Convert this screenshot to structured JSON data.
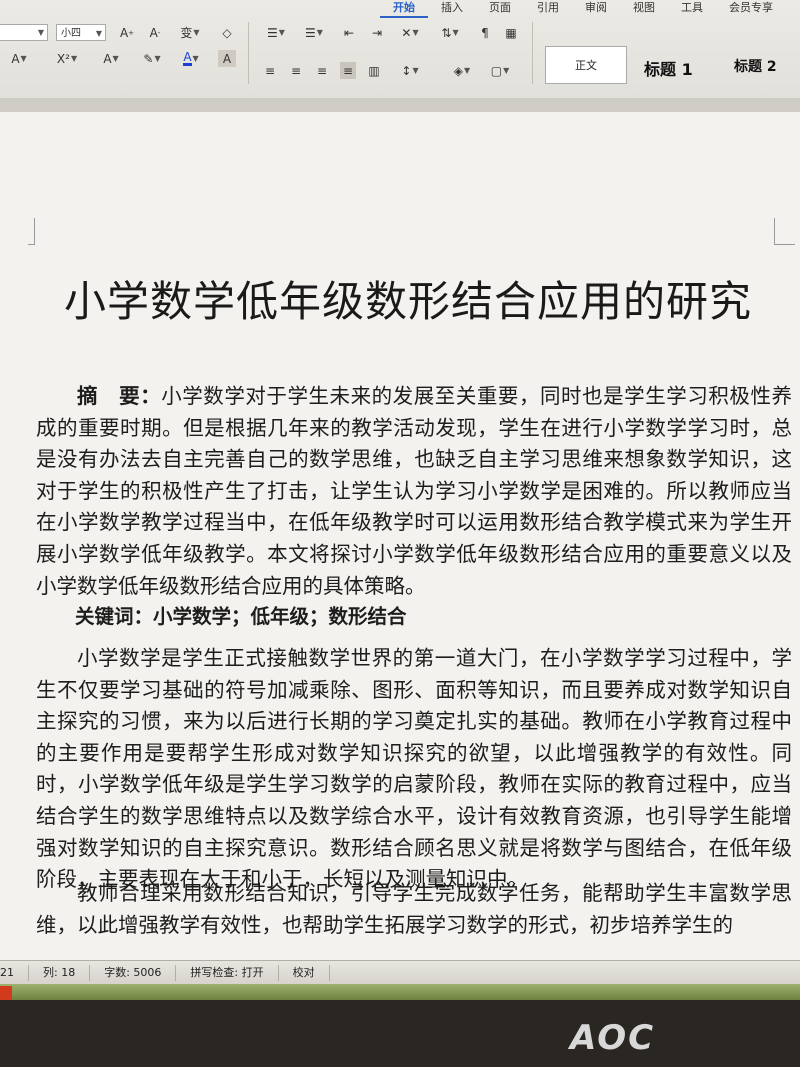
{
  "ribbon": {
    "tabs": [
      {
        "label": "开始",
        "active": true
      },
      {
        "label": "插入"
      },
      {
        "label": "页面"
      },
      {
        "label": "引用"
      },
      {
        "label": "审阅"
      },
      {
        "label": "视图"
      },
      {
        "label": "工具"
      },
      {
        "label": "会员专享"
      }
    ],
    "font_size": "小四",
    "styles": {
      "normal": "正文",
      "heading1": "标题 1",
      "heading2": "标题 2"
    }
  },
  "document": {
    "title": "小学数学低年级数形结合应用的研究",
    "abstract_label": "摘　要：",
    "abstract": "小学数学对于学生未来的发展至关重要，同时也是学生学习积极性养成的重要时期。但是根据几年来的教学活动发现，学生在进行小学数学学习时，总是没有办法去自主完善自己的数学思维，也缺乏自主学习思维来想象数学知识，这对于学生的积极性产生了打击，让学生认为学习小学数学是困难的。所以教师应当在小学数学教学过程当中，在低年级教学时可以运用数形结合教学模式来为学生开展小学数学低年级教学。本文将探讨小学数学低年级数形结合应用的重要意义以及小学数学低年级数形结合应用的具体策略。",
    "keywords_label": "关键词：",
    "keywords": "小学数学；低年级；数形结合",
    "para1": "小学数学是学生正式接触数学世界的第一道大门，在小学数学学习过程中，学生不仅要学习基础的符号加减乘除、图形、面积等知识，而且要养成对数学知识自主探究的习惯，来为以后进行长期的学习奠定扎实的基础。教师在小学教育过程中的主要作用是要帮学生形成对数学知识探究的欲望，以此增强教学的有效性。同时，小学数学低年级是学生学习数学的启蒙阶段，教师在实际的教育过程中，应当结合学生的数学思维特点以及数学综合水平，设计有效教育资源，也引导学生能增强对数学知识的自主探究意识。数形结合顾名思义就是将数学与图结合，在低年级阶段，主要表现在大于和小于，长短以及测量知识中。",
    "para2": "教师合理采用数形结合知识，引导学生完成数学任务，能帮助学生丰富数学思维，以此增强教学有效性，也帮助学生拓展学习数学的形式，初步培养学生的"
  },
  "status": {
    "line": "21",
    "column": "列: 18",
    "word_count": "字数: 5006",
    "spell_check": "拼写检查: 打开",
    "proofread": "校对"
  },
  "bezel": {
    "brand": "AOC"
  }
}
